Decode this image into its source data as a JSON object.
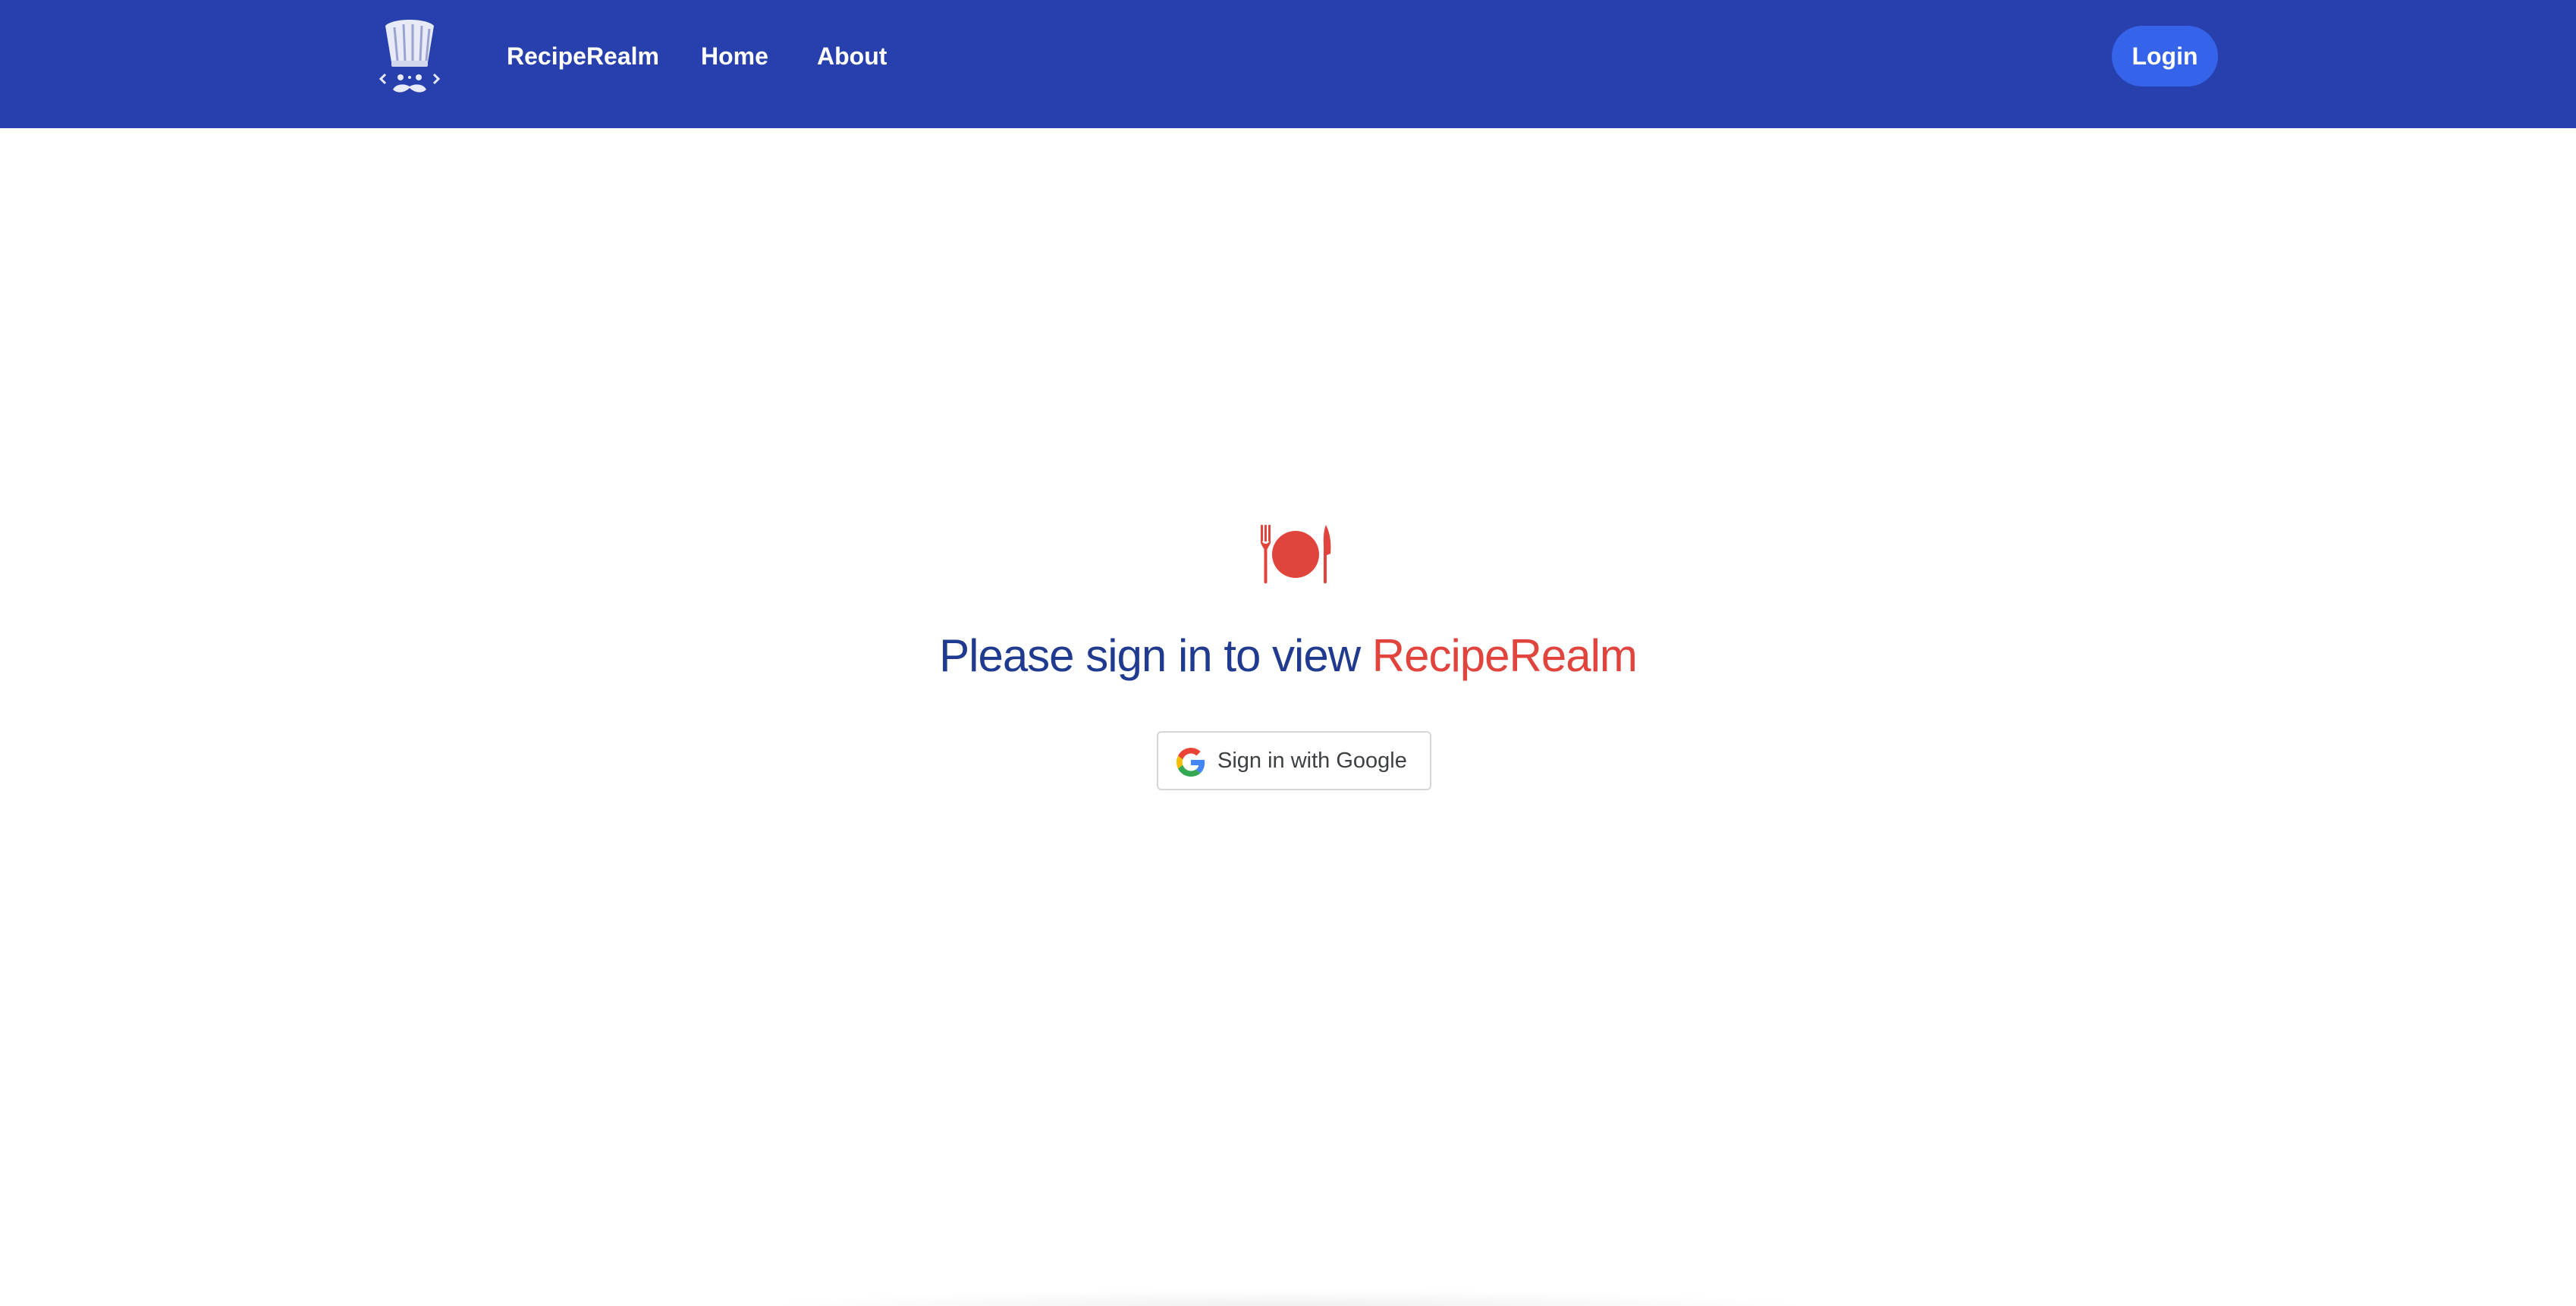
{
  "header": {
    "logo_icon": "chef-hat-mustache-icon",
    "brand": "RecipeRealm",
    "nav": {
      "home": "Home",
      "about": "About"
    },
    "login_label": "Login"
  },
  "main": {
    "icon": "fork-plate-knife-icon",
    "headline_lead": "Please sign in to view",
    "headline_brand": "RecipeRealm",
    "google_button_label": "Sign in with Google",
    "google_icon": "google-g-icon"
  },
  "colors": {
    "navbar": "#2740ad",
    "login_button": "#3563e9",
    "headline": "#1f3a8f",
    "accent": "#e0443c"
  }
}
